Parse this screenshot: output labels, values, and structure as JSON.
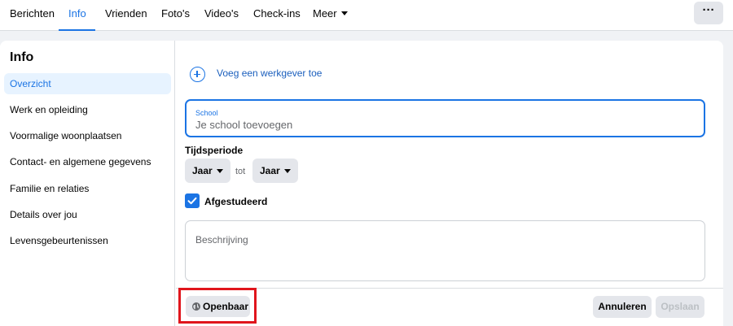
{
  "tabs": [
    {
      "label": "Berichten",
      "active": false
    },
    {
      "label": "Info",
      "active": true
    },
    {
      "label": "Vrienden",
      "active": false
    },
    {
      "label": "Foto's",
      "active": false
    },
    {
      "label": "Video's",
      "active": false
    },
    {
      "label": "Check-ins",
      "active": false
    },
    {
      "label": "Meer",
      "active": false
    }
  ],
  "more_button": {
    "label": "···"
  },
  "sidebar": {
    "title": "Info",
    "items": [
      {
        "label": "Overzicht",
        "active": true
      },
      {
        "label": "Werk en opleiding",
        "active": false
      },
      {
        "label": "Voormalige woonplaatsen",
        "active": false
      },
      {
        "label": "Contact- en algemene gegevens",
        "active": false
      },
      {
        "label": "Familie en relaties",
        "active": false
      },
      {
        "label": "Details over jou",
        "active": false
      },
      {
        "label": "Levensgebeurtenissen",
        "active": false
      }
    ]
  },
  "main": {
    "add_employer_label": "Voeg een werkgever toe",
    "school": {
      "label": "School",
      "placeholder": "Je school toevoegen",
      "value": ""
    },
    "period": {
      "label": "Tijdsperiode",
      "from": "Jaar",
      "separator": "tot",
      "to": "Jaar"
    },
    "graduated": {
      "label": "Afgestudeerd",
      "checked": true
    },
    "description": {
      "placeholder": "Beschrijving",
      "value": ""
    },
    "privacy_label": "Openbaar",
    "cancel_label": "Annuleren",
    "save_label": "Opslaan"
  },
  "colors": {
    "accent": "#1b74e4",
    "highlight": "#e0151c",
    "button_bg": "#e4e6eb"
  },
  "icons": [
    "plus-circle-icon",
    "caret-down-icon",
    "checkmark-icon",
    "globe-icon"
  ]
}
